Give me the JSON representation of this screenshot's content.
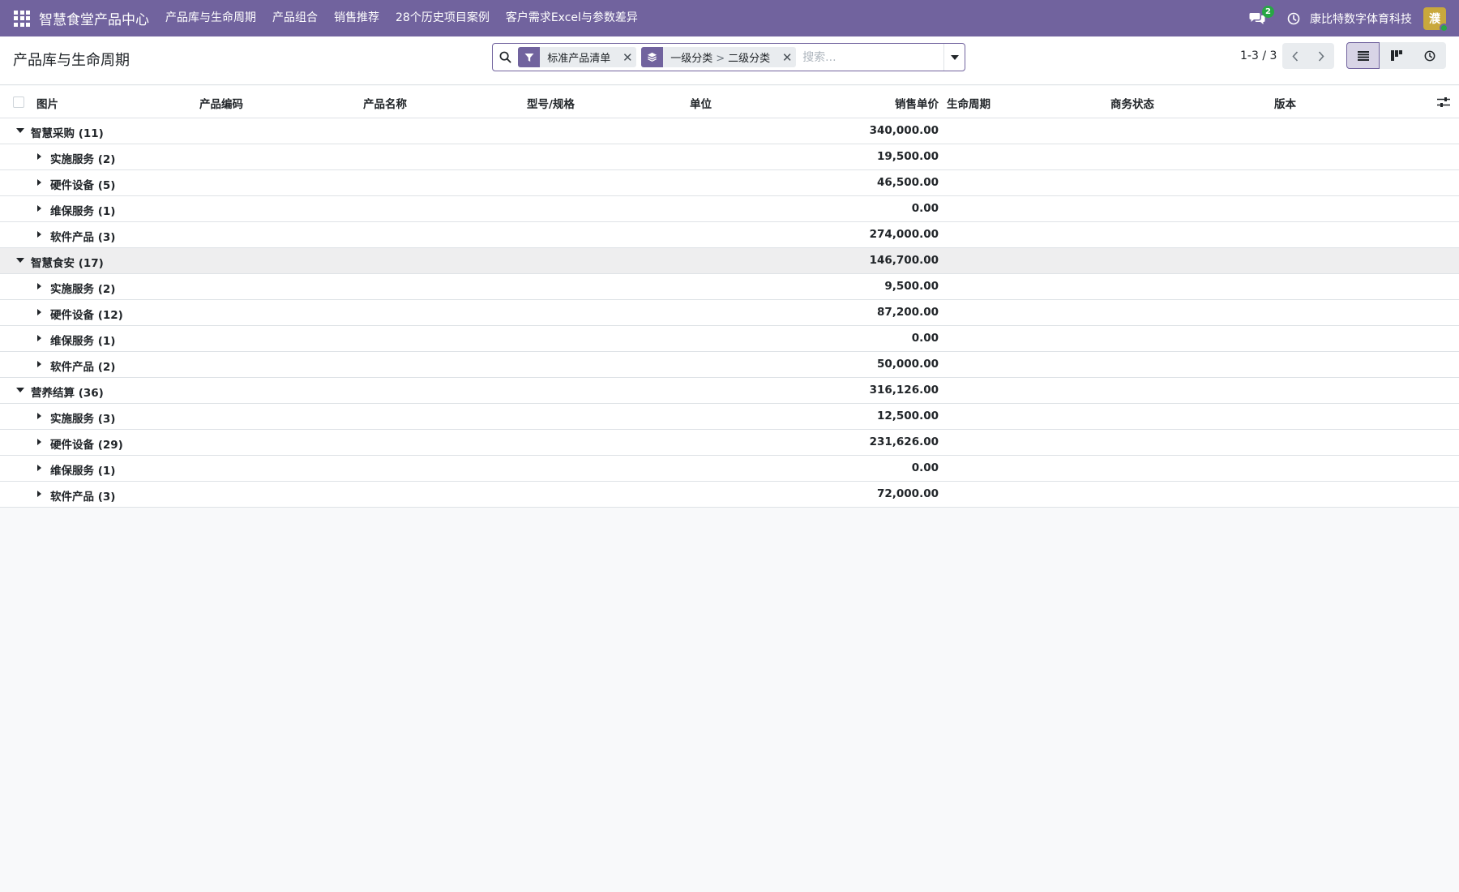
{
  "navbar": {
    "brand": "智慧食堂产品中心",
    "menu": [
      "产品库与生命周期",
      "产品组合",
      "销售推荐",
      "28个历史项目案例",
      "客户需求Excel与参数差异"
    ],
    "chat_count": "2",
    "company": "康比特数字体育科技",
    "avatar_letter": "濮"
  },
  "control_panel": {
    "title": "产品库与生命周期",
    "facets": [
      {
        "icon": "filter-icon",
        "text": "标准产品清单"
      },
      {
        "icon": "group-by-icon",
        "parts": [
          "一级分类",
          ">",
          "二级分类"
        ]
      }
    ],
    "search_placeholder": "搜索...",
    "pager": "1-3 / 3"
  },
  "table": {
    "columns": [
      "图片",
      "产品编码",
      "产品名称",
      "型号/规格",
      "单位",
      "销售单价",
      "生命周期",
      "商务状态",
      "版本"
    ]
  },
  "groups": [
    {
      "label": "智慧采购 (11)",
      "total": "340,000.00",
      "children": [
        {
          "label": "实施服务 (2)",
          "total": "19,500.00"
        },
        {
          "label": "硬件设备 (5)",
          "total": "46,500.00"
        },
        {
          "label": "维保服务 (1)",
          "total": "0.00"
        },
        {
          "label": "软件产品 (3)",
          "total": "274,000.00"
        }
      ]
    },
    {
      "label": "智慧食安 (17)",
      "total": "146,700.00",
      "children": [
        {
          "label": "实施服务 (2)",
          "total": "9,500.00"
        },
        {
          "label": "硬件设备 (12)",
          "total": "87,200.00"
        },
        {
          "label": "维保服务 (1)",
          "total": "0.00"
        },
        {
          "label": "软件产品 (2)",
          "total": "50,000.00"
        }
      ]
    },
    {
      "label": "营养结算 (36)",
      "total": "316,126.00",
      "children": [
        {
          "label": "实施服务 (3)",
          "total": "12,500.00"
        },
        {
          "label": "硬件设备 (29)",
          "total": "231,626.00"
        },
        {
          "label": "维保服务 (1)",
          "total": "0.00"
        },
        {
          "label": "软件产品 (3)",
          "total": "72,000.00"
        }
      ]
    }
  ],
  "colors": {
    "brand": "#71639e",
    "badge": "#28a745",
    "avatar": "#c9a83c"
  }
}
